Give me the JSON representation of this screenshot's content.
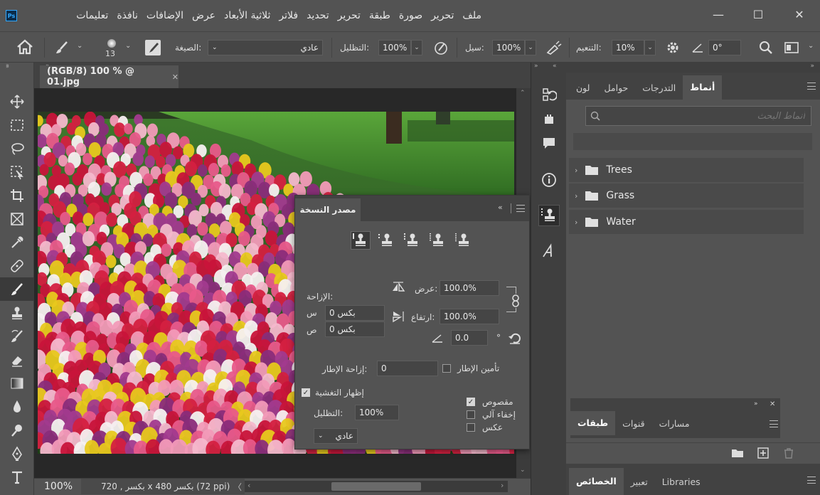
{
  "app": {
    "logo": "Ps"
  },
  "menu": [
    "ملف",
    "تحرير",
    "صورة",
    "طبقة",
    "تحرير",
    "تحديد",
    "فلاتر",
    "ثلاثية الأبعاد",
    "عرض",
    "الإضافات",
    "نافذة",
    "تعليمات"
  ],
  "window_controls": {
    "minimize": "—",
    "maximize": "☐",
    "close": "✕"
  },
  "options": {
    "brush_size": "13",
    "mode_label": "الصيغة:",
    "mode_value": "عادي",
    "opacity_label": "التظليل:",
    "opacity_value": "100%",
    "flow_label": "سيل:",
    "flow_value": "100%",
    "smoothing_label": "التنعيم:",
    "smoothing_value": "10%",
    "angle_value": "0°"
  },
  "document": {
    "tab_title": "(RGB/8) 100 % @ 01.jpg",
    "tab_close": "✕",
    "zoom": "100%",
    "status_info": "720 , بكسر x 480 بكسر (72 ppi)"
  },
  "clone_source": {
    "tab": "مصدر النسخة",
    "offset_label": "الإزاحة:",
    "x_label": "س",
    "x_value": "بكس 0",
    "y_label": "ص",
    "y_value": "بكس 0",
    "width_label": "عرض:",
    "width_value": "100.0%",
    "height_label": "ارتفاع:",
    "height_value": "100.0%",
    "rotation_value": "0.0",
    "degree": "°",
    "frame_lock_label": "تأمين الإطار",
    "frame_offset_label": "إزاحة الإطار:",
    "frame_offset_value": "0",
    "show_overlay_label": "إظهار التغشية",
    "overlay_opacity_label": "التظليل:",
    "overlay_opacity_value": "100%",
    "overlay_mode": "عادي",
    "clipped_label": "مقصوص",
    "auto_hide_label": "إخفاء آلي",
    "invert_label": "عكس"
  },
  "patterns_panel": {
    "tabs": [
      "أنماط",
      "التدرجات",
      "حوامل",
      "لون"
    ],
    "search_placeholder": "أنماط البحث",
    "folders": [
      "Trees",
      "Grass",
      "Water"
    ]
  },
  "layers_panel": {
    "tabs": [
      "طبقات",
      "قنوات",
      "مسارات"
    ]
  },
  "properties_panel": {
    "tabs": [
      "الخصائص",
      "تعبير",
      "Libraries"
    ]
  }
}
